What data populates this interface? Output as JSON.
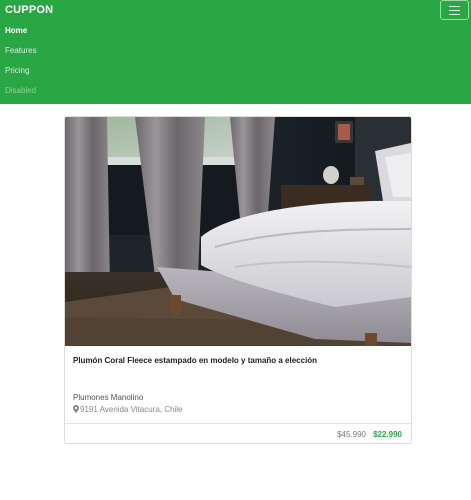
{
  "navbar": {
    "brand": "CUPPON",
    "items": [
      {
        "label": "Home",
        "state": "active"
      },
      {
        "label": "Features",
        "state": "normal"
      },
      {
        "label": "Pricing",
        "state": "normal"
      },
      {
        "label": "Disabled",
        "state": "disabled"
      }
    ],
    "toggler_icon": "hamburger-icon",
    "color": "#2aa745"
  },
  "card": {
    "image_alt": "bedroom-photo",
    "title": "Plumón Coral Fleece estampado en modelo y tamaño a elección",
    "merchant": "Plumones Manolino",
    "address": "9191 Avenida Vitacura, Chile",
    "address_icon": "map-marker-icon",
    "price_original": "$45.990",
    "price_discount": "$22.990",
    "price_color": "#2aa745"
  }
}
